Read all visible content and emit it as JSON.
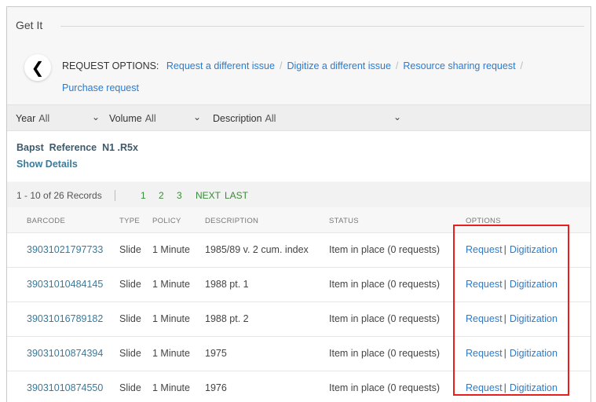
{
  "section": {
    "title": "Get It"
  },
  "request_options": {
    "label": "REQUEST OPTIONS:",
    "links": [
      "Request a different issue",
      "Digitize a different issue",
      "Resource sharing request",
      "Purchase request"
    ]
  },
  "filters": {
    "year": {
      "label": "Year",
      "value": "All"
    },
    "volume": {
      "label": "Volume",
      "value": "All"
    },
    "description": {
      "label": "Description",
      "value": "All"
    }
  },
  "location": {
    "name": "Bapst  Reference  N1 .R5x",
    "show_details": "Show Details"
  },
  "pager": {
    "count": "1 - 10 of 26 Records",
    "pages": [
      "1",
      "2",
      "3"
    ],
    "next": "NEXT",
    "last": "LAST"
  },
  "table": {
    "headers": [
      "BARCODE",
      "TYPE",
      "POLICY",
      "DESCRIPTION",
      "STATUS",
      "OPTIONS"
    ],
    "rows": [
      {
        "barcode": "39031021797733",
        "type": "Slide",
        "policy": "1 Minute",
        "description": "1985/89 v. 2 cum. index",
        "status": "Item in place (0 requests)",
        "request": "Request",
        "sep": "|",
        "digitization": "Digitization"
      },
      {
        "barcode": "39031010484145",
        "type": "Slide",
        "policy": "1 Minute",
        "description": "1988 pt. 1",
        "status": "Item in place (0 requests)",
        "request": "Request",
        "sep": "|",
        "digitization": "Digitization"
      },
      {
        "barcode": "39031016789182",
        "type": "Slide",
        "policy": "1 Minute",
        "description": "1988 pt. 2",
        "status": "Item in place (0 requests)",
        "request": "Request",
        "sep": "|",
        "digitization": "Digitization"
      },
      {
        "barcode": "39031010874394",
        "type": "Slide",
        "policy": "1 Minute",
        "description": "1975",
        "status": "Item in place (0 requests)",
        "request": "Request",
        "sep": "|",
        "digitization": "Digitization"
      },
      {
        "barcode": "39031010874550",
        "type": "Slide",
        "policy": "1 Minute",
        "description": "1976",
        "status": "Item in place (0 requests)",
        "request": "Request",
        "sep": "|",
        "digitization": "Digitization"
      }
    ]
  },
  "colors": {
    "link": "#2a7bd0",
    "highlight": "#e81f1f",
    "pager_link": "#3a8a3a"
  },
  "icons": {
    "back": "chevron-left-icon",
    "dropdown": "chevron-down-icon"
  }
}
